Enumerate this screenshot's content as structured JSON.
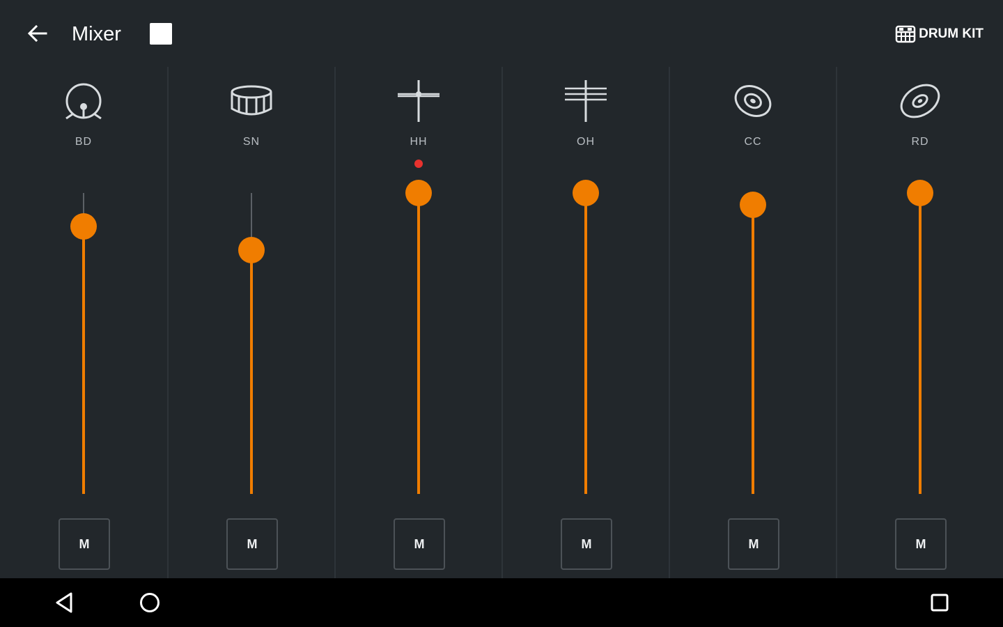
{
  "header": {
    "title": "Mixer",
    "drumkit_label": "DRUM KIT",
    "back_icon": "arrow-left-icon",
    "stop_icon": "stop-square-icon",
    "drumkit_icon": "drum-kit-icon"
  },
  "colors": {
    "background": "#22272b",
    "accent": "#f07d00",
    "peak": "#e8322e",
    "label": "#b9bec3"
  },
  "channels": [
    {
      "label": "BD",
      "icon": "bass-drum-icon",
      "level": 0.89,
      "peak": false,
      "mute_label": "M"
    },
    {
      "label": "SN",
      "icon": "snare-drum-icon",
      "level": 0.81,
      "peak": false,
      "mute_label": "M"
    },
    {
      "label": "HH",
      "icon": "hi-hat-icon",
      "level": 1.0,
      "peak": true,
      "mute_label": "M"
    },
    {
      "label": "OH",
      "icon": "open-hi-hat-icon",
      "level": 1.0,
      "peak": false,
      "mute_label": "M"
    },
    {
      "label": "CC",
      "icon": "crash-cymbal-icon",
      "level": 0.96,
      "peak": false,
      "mute_label": "M"
    },
    {
      "label": "RD",
      "icon": "ride-cymbal-icon",
      "level": 1.0,
      "peak": false,
      "mute_label": "M"
    }
  ],
  "navbar": {
    "back_icon": "nav-back-icon",
    "home_icon": "nav-home-icon",
    "recents_icon": "nav-recents-icon"
  }
}
